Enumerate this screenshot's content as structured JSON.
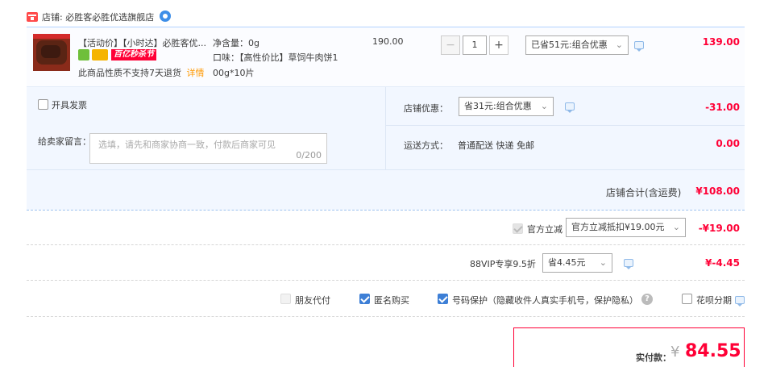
{
  "shop": {
    "label": "店铺: 必胜客必胜优选旗舰店"
  },
  "item": {
    "title": "【活动价】【小时达】必胜客优...",
    "badge": "百亿秒杀节",
    "note": "此商品性质不支持7天退货",
    "note_link": "详情",
    "spec_weight": "净含量：0g",
    "spec_flavor_1": "口味：【高性价比】草饲牛肉饼1",
    "spec_flavor_2": "00g*10片",
    "unit_price": "190.00",
    "qty": "1",
    "qty_minus": "−",
    "qty_plus": "+",
    "discount_select": "已省51元:组合优惠",
    "subtotal": "139.00"
  },
  "invoice": {
    "label": "开具发票"
  },
  "shop_discount": {
    "label": "店铺优惠：",
    "select": "省31元:组合优惠",
    "value": "-31.00"
  },
  "message": {
    "label": "给卖家留言：",
    "placeholder": "选填，请先和商家协商一致，付款后商家可见",
    "counter": "0/200"
  },
  "shipping": {
    "label": "运送方式：",
    "method": "普通配送 快递 免邮",
    "value": "0.00"
  },
  "shop_total": {
    "label": "店铺合计(含运费)",
    "value": "¥108.00"
  },
  "official": {
    "label": "官方立减",
    "select": "官方立减抵扣¥19.00元",
    "value": "-¥19.00"
  },
  "vip": {
    "label": "88VIP专享9.5折",
    "select": "省4.45元",
    "value": "¥-4.45"
  },
  "options": {
    "friend_pay": "朋友代付",
    "anonymous": "匿名购买",
    "number_protect": "号码保护（隐藏收件人真实手机号，保护隐私）",
    "installment": "花呗分期"
  },
  "pay": {
    "label": "实付款：",
    "currency": "¥",
    "amount": "84.55"
  },
  "colors": {
    "accent_red": "#ff0036",
    "panel_blue": "#f2f7ff",
    "checkbox_blue": "#3d7fd6"
  }
}
